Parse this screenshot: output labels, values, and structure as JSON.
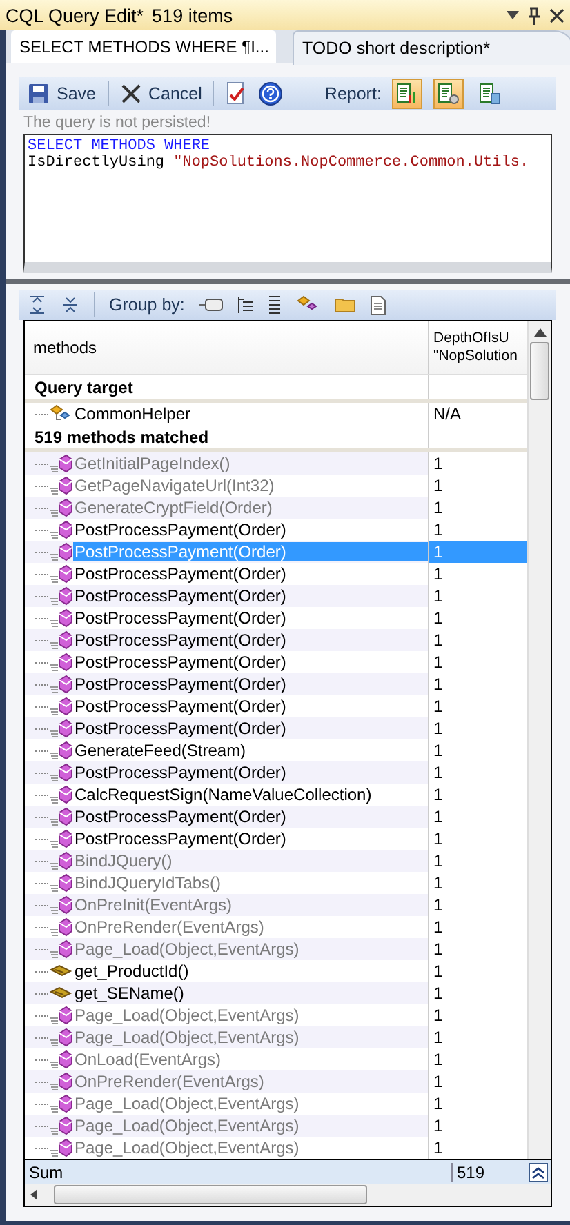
{
  "panel": {
    "title": "CQL Query Edit*",
    "count": "519 items"
  },
  "tabs": [
    {
      "label": "SELECT METHODS WHERE ¶I...",
      "selected": true
    },
    {
      "label": "TODO short description*",
      "selected": false
    }
  ],
  "toolbar": {
    "buttons": [
      {
        "kind": "save",
        "label": "Save"
      },
      {
        "kind": "cancel",
        "label": "Cancel"
      },
      {
        "kind": "check"
      },
      {
        "kind": "help"
      }
    ],
    "report_label": "Report:",
    "report_views": [
      {
        "kind": "chart",
        "on": true
      },
      {
        "kind": "list",
        "on": true
      },
      {
        "kind": "grid",
        "on": false
      }
    ]
  },
  "status_note": "The query is not persisted!",
  "query_lines": [
    [
      {
        "kind": "keyword",
        "text": "SELECT METHODS WHERE"
      }
    ],
    [
      {
        "kind": "plain",
        "text": "IsDirectlyUsing "
      },
      {
        "kind": "string",
        "text": "\"NopSolutions.NopCommerce.Common.Utils."
      }
    ]
  ],
  "grid_toolbar": {
    "group_by_label": "Group by:"
  },
  "table": {
    "columns": [
      {
        "lines": [
          "methods"
        ]
      },
      {
        "lines": [
          "DepthOfIsU",
          "\"NopSolution"
        ]
      }
    ],
    "sections": [
      {
        "title": "Query target",
        "rows": [
          {
            "kind": "type",
            "name": "CommonHelper",
            "value": "N/A",
            "dimmed": false,
            "selected": false
          }
        ]
      },
      {
        "title": "519 methods matched",
        "rows": [
          {
            "kind": "method",
            "name": "GetInitialPageIndex()",
            "value": "1",
            "dimmed": true,
            "selected": false
          },
          {
            "kind": "method",
            "name": "GetPageNavigateUrl(Int32)",
            "value": "1",
            "dimmed": true,
            "selected": false
          },
          {
            "kind": "method",
            "name": "GenerateCryptField(Order)",
            "value": "1",
            "dimmed": true,
            "selected": false
          },
          {
            "kind": "method",
            "name": "PostProcessPayment(Order)",
            "value": "1",
            "dimmed": false,
            "selected": false
          },
          {
            "kind": "method",
            "name": "PostProcessPayment(Order)",
            "value": "1",
            "dimmed": false,
            "selected": true
          },
          {
            "kind": "method",
            "name": "PostProcessPayment(Order)",
            "value": "1",
            "dimmed": false,
            "selected": false
          },
          {
            "kind": "method",
            "name": "PostProcessPayment(Order)",
            "value": "1",
            "dimmed": false,
            "selected": false
          },
          {
            "kind": "method",
            "name": "PostProcessPayment(Order)",
            "value": "1",
            "dimmed": false,
            "selected": false
          },
          {
            "kind": "method",
            "name": "PostProcessPayment(Order)",
            "value": "1",
            "dimmed": false,
            "selected": false
          },
          {
            "kind": "method",
            "name": "PostProcessPayment(Order)",
            "value": "1",
            "dimmed": false,
            "selected": false
          },
          {
            "kind": "method",
            "name": "PostProcessPayment(Order)",
            "value": "1",
            "dimmed": false,
            "selected": false
          },
          {
            "kind": "method",
            "name": "PostProcessPayment(Order)",
            "value": "1",
            "dimmed": false,
            "selected": false
          },
          {
            "kind": "method",
            "name": "PostProcessPayment(Order)",
            "value": "1",
            "dimmed": false,
            "selected": false
          },
          {
            "kind": "method",
            "name": "GenerateFeed(Stream)",
            "value": "1",
            "dimmed": false,
            "selected": false
          },
          {
            "kind": "method",
            "name": "PostProcessPayment(Order)",
            "value": "1",
            "dimmed": false,
            "selected": false
          },
          {
            "kind": "method",
            "name": "CalcRequestSign(NameValueCollection)",
            "value": "1",
            "dimmed": false,
            "selected": false
          },
          {
            "kind": "method",
            "name": "PostProcessPayment(Order)",
            "value": "1",
            "dimmed": false,
            "selected": false
          },
          {
            "kind": "method",
            "name": "PostProcessPayment(Order)",
            "value": "1",
            "dimmed": false,
            "selected": false
          },
          {
            "kind": "method",
            "name": "BindJQuery()",
            "value": "1",
            "dimmed": true,
            "selected": false
          },
          {
            "kind": "method",
            "name": "BindJQueryIdTabs()",
            "value": "1",
            "dimmed": true,
            "selected": false
          },
          {
            "kind": "method",
            "name": "OnPreInit(EventArgs)",
            "value": "1",
            "dimmed": true,
            "selected": false
          },
          {
            "kind": "method",
            "name": "OnPreRender(EventArgs)",
            "value": "1",
            "dimmed": true,
            "selected": false
          },
          {
            "kind": "method",
            "name": "Page_Load(Object,EventArgs)",
            "value": "1",
            "dimmed": true,
            "selected": false
          },
          {
            "kind": "property",
            "name": "get_ProductId()",
            "value": "1",
            "dimmed": false,
            "selected": false
          },
          {
            "kind": "property",
            "name": "get_SEName()",
            "value": "1",
            "dimmed": false,
            "selected": false
          },
          {
            "kind": "method",
            "name": "Page_Load(Object,EventArgs)",
            "value": "1",
            "dimmed": true,
            "selected": false
          },
          {
            "kind": "method",
            "name": "Page_Load(Object,EventArgs)",
            "value": "1",
            "dimmed": true,
            "selected": false
          },
          {
            "kind": "method",
            "name": "OnLoad(EventArgs)",
            "value": "1",
            "dimmed": true,
            "selected": false
          },
          {
            "kind": "method",
            "name": "OnPreRender(EventArgs)",
            "value": "1",
            "dimmed": true,
            "selected": false
          },
          {
            "kind": "method",
            "name": "Page_Load(Object,EventArgs)",
            "value": "1",
            "dimmed": true,
            "selected": false
          },
          {
            "kind": "method",
            "name": "Page_Load(Object,EventArgs)",
            "value": "1",
            "dimmed": true,
            "selected": false
          },
          {
            "kind": "method",
            "name": "Page_Load(Object,EventArgs)",
            "value": "1",
            "dimmed": true,
            "selected": false
          }
        ]
      }
    ],
    "sum": {
      "label": "Sum",
      "value": "519"
    }
  }
}
